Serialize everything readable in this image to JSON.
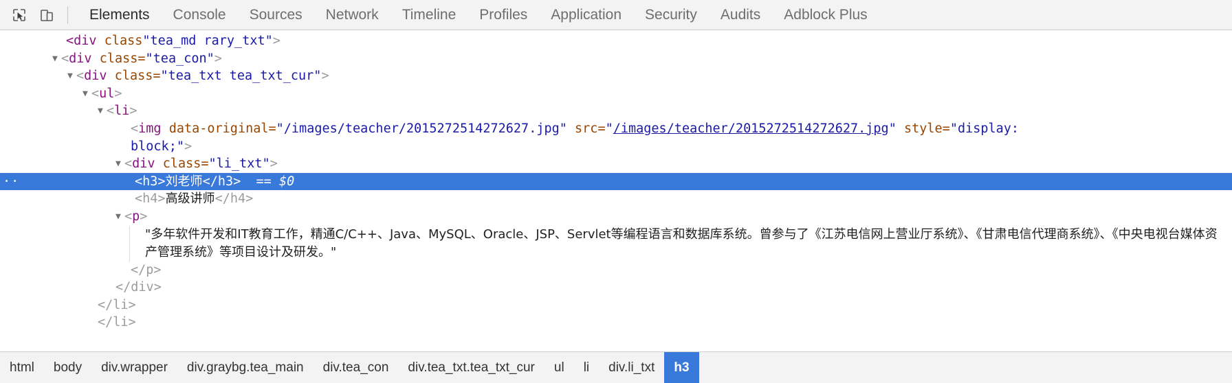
{
  "toolbar": {
    "inspect_icon": "inspect-cursor-icon",
    "device_icon": "device-toolbar-icon",
    "tabs": [
      {
        "label": "Elements",
        "active": true
      },
      {
        "label": "Console",
        "active": false
      },
      {
        "label": "Sources",
        "active": false
      },
      {
        "label": "Network",
        "active": false
      },
      {
        "label": "Timeline",
        "active": false
      },
      {
        "label": "Profiles",
        "active": false
      },
      {
        "label": "Application",
        "active": false
      },
      {
        "label": "Security",
        "active": false
      },
      {
        "label": "Audits",
        "active": false
      },
      {
        "label": "Adblock Plus",
        "active": false
      }
    ]
  },
  "dom": {
    "clipped_line": {
      "tag_open": "<div",
      "attr": "class",
      "value": "\"tea_md rary_txt\"",
      "tag_close": ">"
    },
    "lines": {
      "tea_con": {
        "open_lt": "<",
        "tag": "div",
        "space": " ",
        "attr": "class=",
        "value": "\"tea_con\"",
        "close_gt": ">"
      },
      "tea_txt": {
        "open_lt": "<",
        "tag": "div",
        "attr": "class=",
        "value": "\"tea_txt tea_txt_cur\"",
        "close_gt": ">"
      },
      "ul": {
        "open_lt": "<",
        "tag": "ul",
        "close_gt": ">"
      },
      "li": {
        "open_lt": "<",
        "tag": "li",
        "close_gt": ">"
      },
      "img": {
        "open_lt": "<",
        "tag": "img",
        "attr1": "data-original=",
        "value1": "\"/images/teacher/2015272514272627.jpg\"",
        "attr2": "src=",
        "value2_quote_open": "\"",
        "value2_link": "/images/teacher/2015272514272627.jpg",
        "value2_quote_close": "\"",
        "attr3": "style=",
        "value3_part1": "\"display:",
        "value3_part2": "block;\"",
        "close_gt": ">"
      },
      "li_txt": {
        "open_lt": "<",
        "tag": "div",
        "attr": "class=",
        "value": "\"li_txt\"",
        "close_gt": ">"
      },
      "h3": {
        "open": "<h3>",
        "text": "刘老师",
        "close": "</h3>",
        "selected_marker": "== $0",
        "ellipsis": "··"
      },
      "h4": {
        "open": "<h4>",
        "text": "高级讲师",
        "close": "</h4>"
      },
      "p_open": {
        "open_lt": "<",
        "tag": "p",
        "close_gt": ">"
      },
      "p_text": "\"多年软件开发和IT教育工作，精通C/C++、Java、MySQL、Oracle、JSP、Servlet等编程语言和数据库系统。曾参与了《江苏电信网上营业厅系统》、《甘肃电信代理商系统》、《中央电视台媒体资产管理系统》等项目设计及研发。\"",
      "p_close": "</p>",
      "div_close": "</div>",
      "li_close": "</li>",
      "li_next_clipped": "</li>"
    }
  },
  "breadcrumb": {
    "items": [
      {
        "label": "html",
        "active": false
      },
      {
        "label": "body",
        "active": false
      },
      {
        "label": "div.wrapper",
        "active": false
      },
      {
        "label": "div.graybg.tea_main",
        "active": false
      },
      {
        "label": "div.tea_con",
        "active": false
      },
      {
        "label": "div.tea_txt.tea_txt_cur",
        "active": false
      },
      {
        "label": "ul",
        "active": false
      },
      {
        "label": "li",
        "active": false
      },
      {
        "label": "div.li_txt",
        "active": false
      },
      {
        "label": "h3",
        "active": true
      }
    ]
  },
  "colors": {
    "selection_blue": "#3879d9",
    "tag_purple": "#881280",
    "attr_orange": "#994500",
    "value_blue": "#1a1aa6",
    "toolbar_gray": "#f3f3f3"
  }
}
